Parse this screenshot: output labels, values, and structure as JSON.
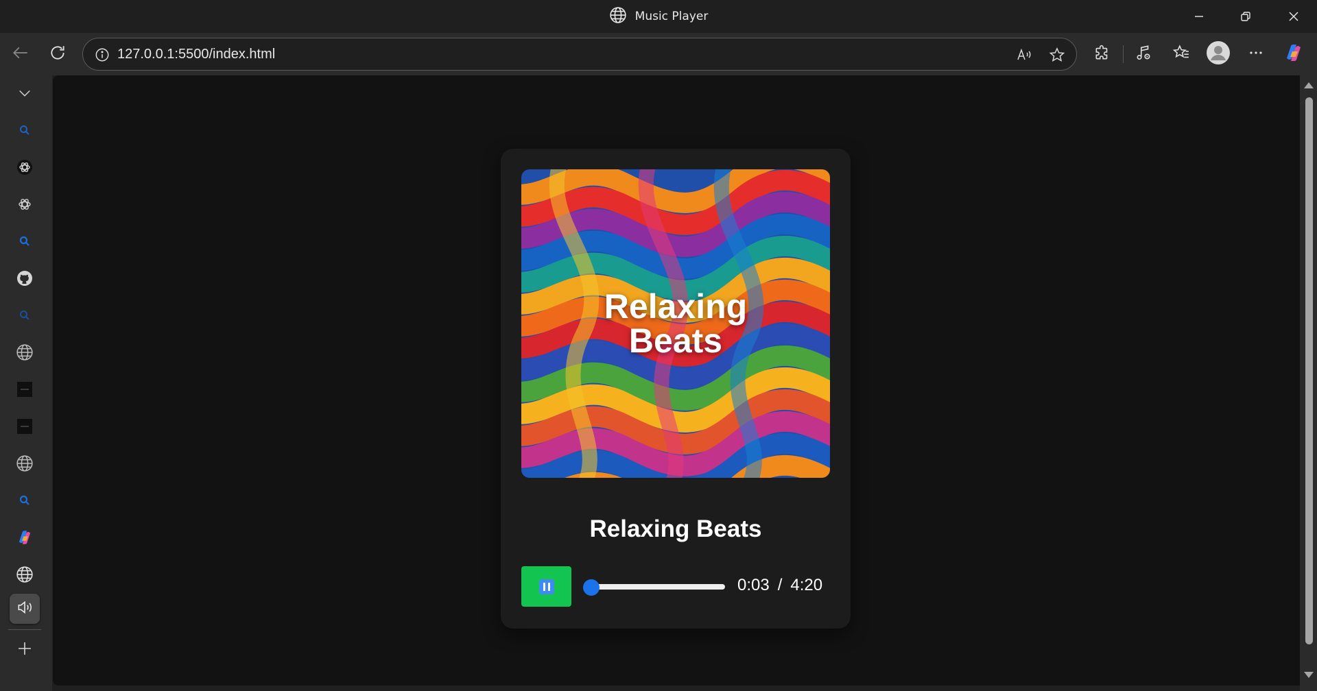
{
  "window": {
    "title": "Music Player"
  },
  "browser": {
    "url": "127.0.0.1:5500/index.html"
  },
  "colors": {
    "play_button": "#14c451",
    "progress_accent": "#1a73e8",
    "card_background": "#1c1c1c",
    "page_background": "#121212"
  },
  "icons": {
    "window_title": "globe-icon",
    "back": "arrow-left-icon",
    "refresh": "refresh-icon",
    "site_info": "info-icon",
    "read_aloud": "read-aloud-icon",
    "favorite": "star-icon",
    "extensions": "puzzle-icon",
    "media": "music-note-icon",
    "favorites": "favorites-icon",
    "profile": "avatar-icon",
    "more": "more-icon",
    "copilot": "copilot-icon"
  },
  "sidebar": {
    "items": [
      {
        "icon": "chevron-down-icon"
      },
      {
        "icon": "search-icon"
      },
      {
        "icon": "openai-icon"
      },
      {
        "icon": "openai-icon"
      },
      {
        "icon": "search-icon"
      },
      {
        "icon": "github-icon"
      },
      {
        "icon": "search-icon"
      },
      {
        "icon": "globe-icon"
      },
      {
        "icon": "tab-thumbnail-icon"
      },
      {
        "icon": "tab-thumbnail-icon"
      },
      {
        "icon": "globe-icon"
      },
      {
        "icon": "search-icon"
      },
      {
        "icon": "copilot-icon"
      },
      {
        "icon": "globe-icon"
      },
      {
        "icon": "speaker-icon",
        "active": true
      },
      {
        "icon": "plus-icon"
      }
    ]
  },
  "player": {
    "cover_text": "Relaxing Beats",
    "song_title": "Relaxing Beats",
    "current_time": "0:03",
    "separator": "/",
    "duration": "4:20",
    "progress": 0.012,
    "state": "playing",
    "button_icon": "pause-icon"
  }
}
